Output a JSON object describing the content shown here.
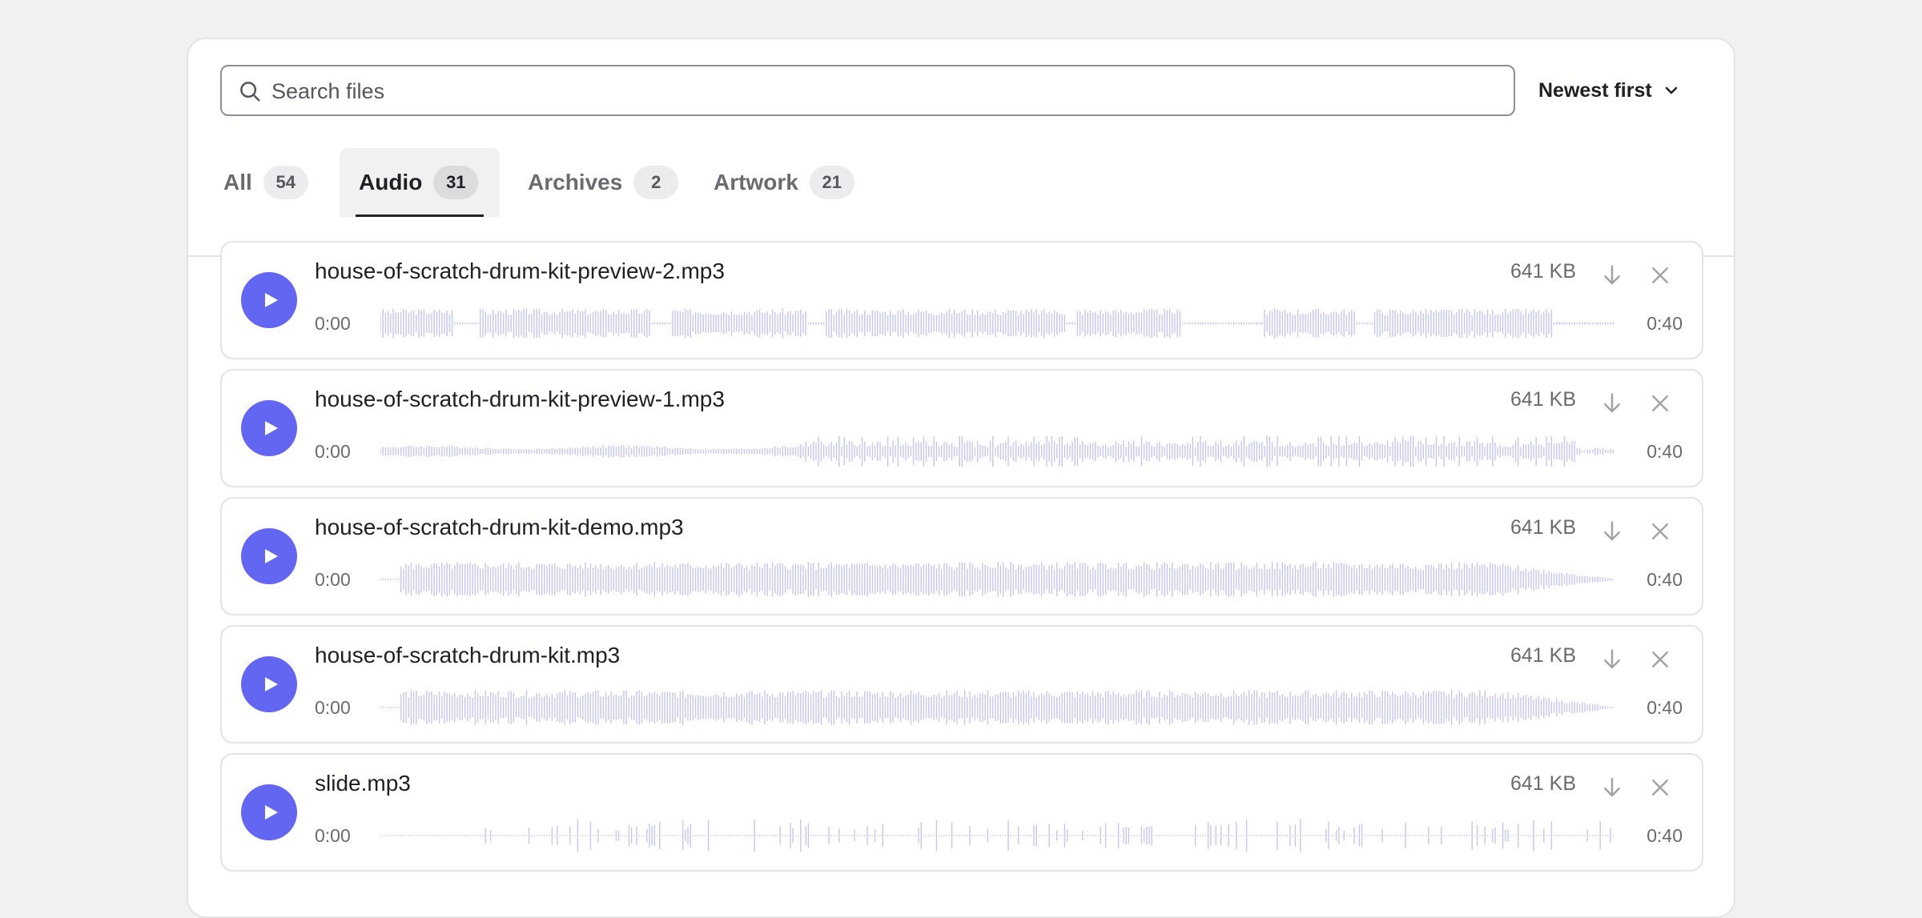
{
  "search": {
    "placeholder": "Search files",
    "value": ""
  },
  "sort": {
    "label": "Newest first"
  },
  "tabs": [
    {
      "label": "All",
      "count": "54",
      "active": false
    },
    {
      "label": "Audio",
      "count": "31",
      "active": true
    },
    {
      "label": "Archives",
      "count": "2",
      "active": false
    },
    {
      "label": "Artwork",
      "count": "21",
      "active": false
    }
  ],
  "files": [
    {
      "name": "house-of-scratch-drum-kit-preview-2.mp3",
      "size": "641 KB",
      "start": "0:00",
      "end": "0:40"
    },
    {
      "name": "house-of-scratch-drum-kit-preview-1.mp3",
      "size": "641 KB",
      "start": "0:00",
      "end": "0:40"
    },
    {
      "name": "house-of-scratch-drum-kit-demo.mp3",
      "size": "641 KB",
      "start": "0:00",
      "end": "0:40"
    },
    {
      "name": "house-of-scratch-drum-kit.mp3",
      "size": "641 KB",
      "start": "0:00",
      "end": "0:40"
    },
    {
      "name": "slide.mp3",
      "size": "641 KB",
      "start": "0:00",
      "end": "0:40"
    }
  ],
  "colors": {
    "accent": "#6366f1",
    "waveform": "#c5c6ec",
    "border": "#e4e4e6",
    "muted_text": "#6a6b70"
  },
  "icons": {
    "search": "search-icon",
    "sort": "chevron-down-icon",
    "play": "play-icon",
    "download": "download-icon",
    "remove": "close-icon"
  }
}
